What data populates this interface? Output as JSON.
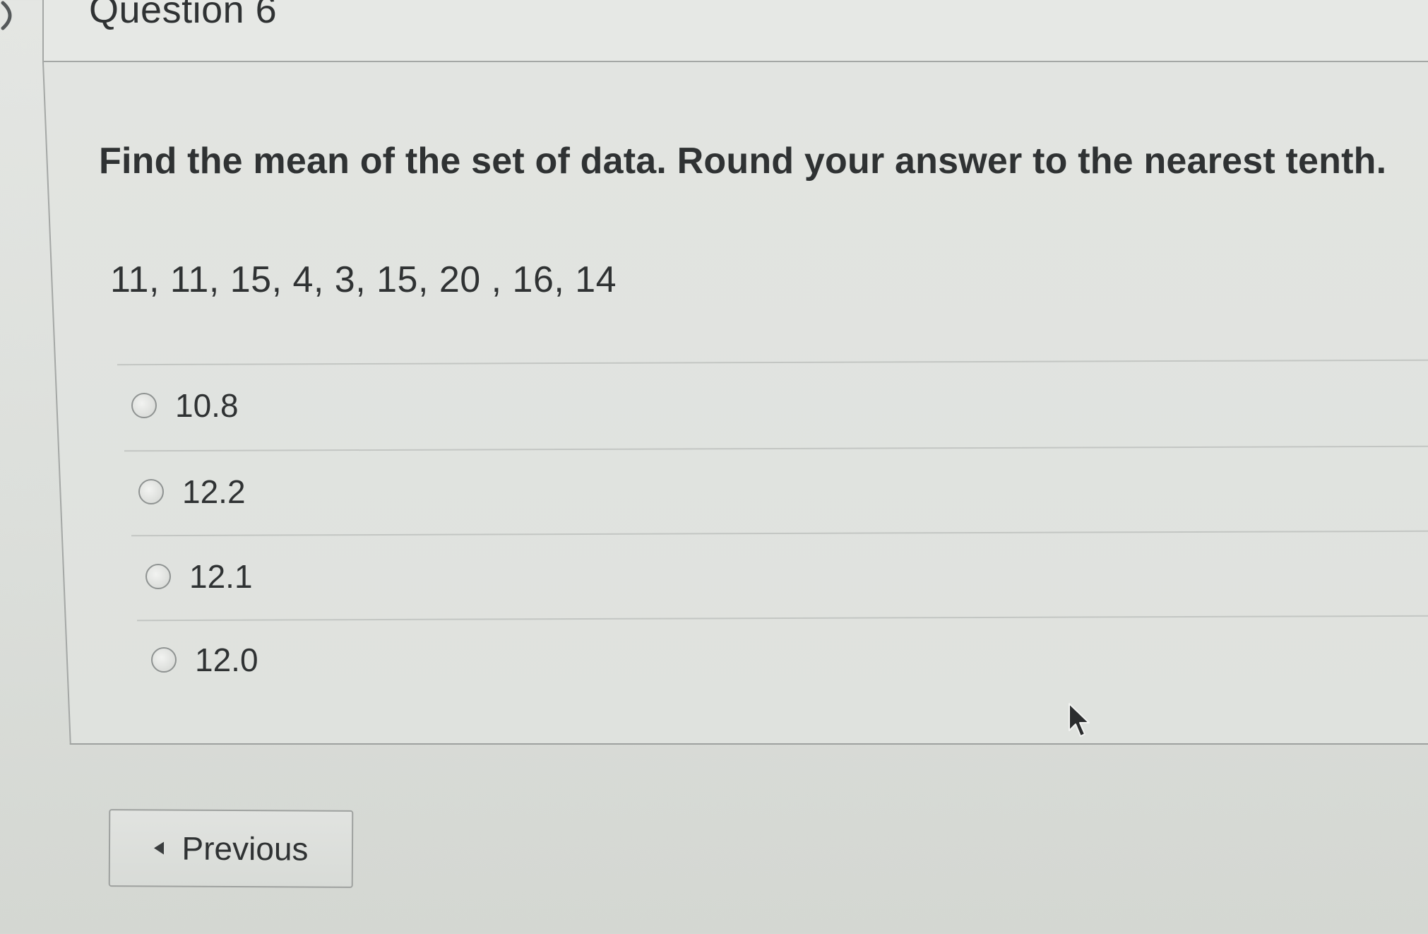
{
  "question": {
    "title": "Question 6",
    "prompt": "Find the mean of the set of data. Round your answer to the nearest tenth.",
    "data_set": "11, 11, 15, 4, 3, 15, 20 , 16, 14"
  },
  "options": [
    {
      "label": "10.8",
      "selected": false
    },
    {
      "label": "12.2",
      "selected": false
    },
    {
      "label": "12.1",
      "selected": false
    },
    {
      "label": "12.0",
      "selected": false
    }
  ],
  "navigation": {
    "previous_label": "Previous"
  },
  "icons": {
    "back": "chevron-right-icon",
    "previous": "caret-left-icon",
    "cursor": "mouse-pointer-icon",
    "option": "radio-icon"
  }
}
